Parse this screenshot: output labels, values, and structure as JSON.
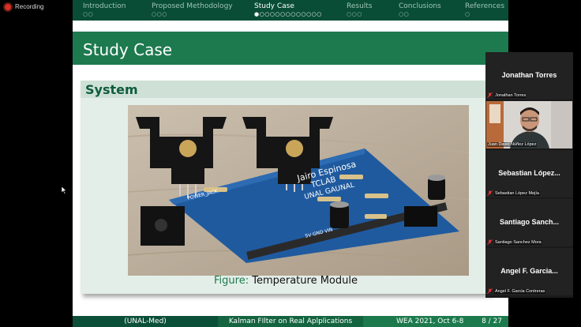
{
  "recording": {
    "label": "Recording"
  },
  "nav": {
    "sections": [
      {
        "label": "Introduction",
        "dots": "○○"
      },
      {
        "label": "Proposed Methodology",
        "dots": "○○○"
      },
      {
        "label": "Study Case",
        "dots": "●○○○○○○○○○○○○"
      },
      {
        "label": "Results",
        "dots": "○○○"
      },
      {
        "label": "Conclusions",
        "dots": "○○"
      },
      {
        "label": "References",
        "dots": "○"
      }
    ],
    "active_index": 2
  },
  "slide": {
    "title": "Study Case",
    "block_title": "System",
    "board_text": {
      "line1": "Jairo Espinosa",
      "line2": "TCLAB",
      "line3": "UNAL GAUNAL",
      "power_jack": "POWER_JACK",
      "pins": "5V GND VIN"
    },
    "caption_key": "Figure:",
    "caption_text": "Temperature Module"
  },
  "footer": {
    "institution": "(UNAL-Med)",
    "talk_title": "Kalman FIlter on Real Aplplications",
    "conference": "WEA 2021, Oct 6-8",
    "page": "8 / 27"
  },
  "participants": [
    {
      "display": "Jonathan Torres",
      "name": "Jonathan Torres",
      "video": false
    },
    {
      "display": "",
      "name": "Juan David Núñez López",
      "video": true
    },
    {
      "display": "Sebastian López...",
      "name": "Sebastian López Mejía",
      "video": false
    },
    {
      "display": "Santiago Sanch...",
      "name": "Santiago Sanchez Mora",
      "video": false
    },
    {
      "display": "Angel F. Garcia...",
      "name": "Angel F. Garcia Contreras",
      "video": false
    }
  ],
  "colors": {
    "nav": "#094d37",
    "title_bar": "#1d7a4f",
    "block_head": "#cfe1d6",
    "accent": "#1d7a4f",
    "recording_dot": "#d93025"
  }
}
